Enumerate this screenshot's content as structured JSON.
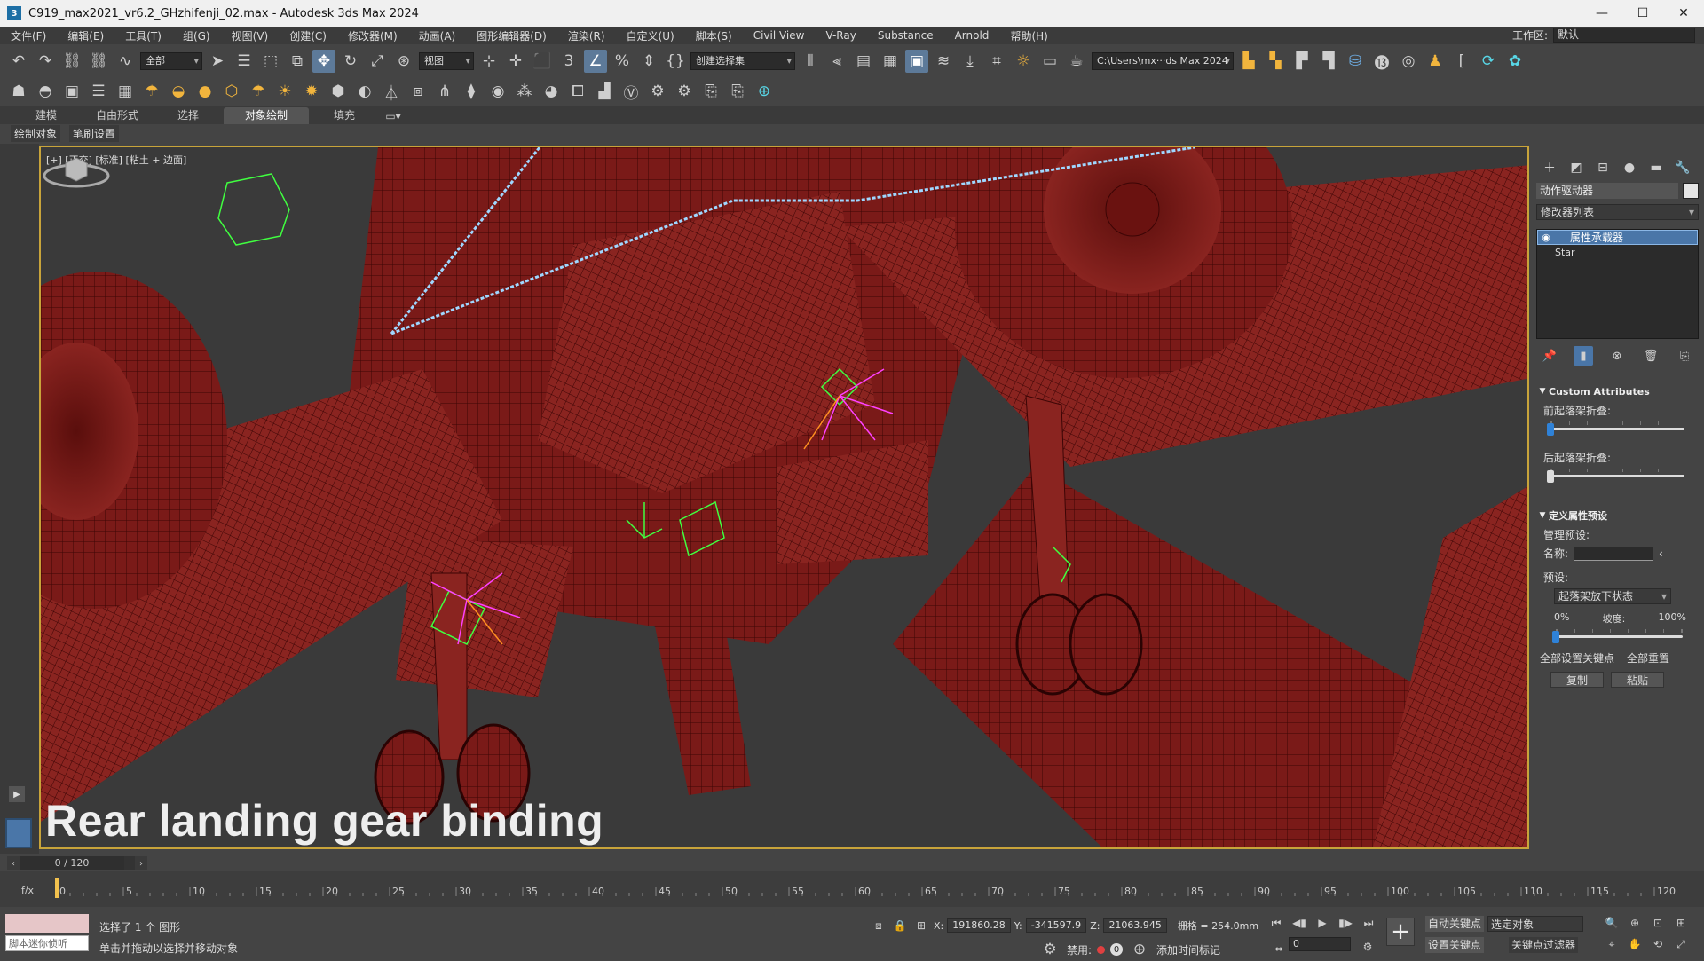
{
  "window": {
    "title": "C919_max2021_vr6.2_GHzhifenji_02.max - Autodesk 3ds Max 2024",
    "logo": "3",
    "controls": [
      "—",
      "☐",
      "✕"
    ]
  },
  "menu": [
    "文件(F)",
    "编辑(E)",
    "工具(T)",
    "组(G)",
    "视图(V)",
    "创建(C)",
    "修改器(M)",
    "动画(A)",
    "图形编辑器(D)",
    "渲染(R)",
    "自定义(U)",
    "脚本(S)",
    "Civil View",
    "V-Ray",
    "Substance",
    "Arnold",
    "帮助(H)"
  ],
  "workspace": {
    "label": "工作区:",
    "value": "默认"
  },
  "toolbar": {
    "filter_select": "全部",
    "ref_coord_select": "视图",
    "named_selection": "创建选择集",
    "project_path": "C:\\Users\\mx···ds Max 2024"
  },
  "ribbon": {
    "tabs": [
      "建模",
      "自由形式",
      "选择",
      "对象绘制",
      "填充"
    ],
    "active_tab": "对象绘制",
    "subtabs": [
      "绘制对象",
      "笔刷设置"
    ]
  },
  "viewport": {
    "label": "[+] [正交] [标准] [粘土 + 边面]",
    "caption": "Rear landing gear binding",
    "colors": {
      "mesh": "#7a1a18",
      "wire": "#3c0505",
      "background": "#3a3a3a",
      "border": "#c8a43a",
      "spline": "#9fd7ff"
    }
  },
  "command_panel": {
    "object_name": "动作驱动器",
    "modifier_list": "修改器列表",
    "stack": [
      "属性承载器",
      "Star"
    ],
    "rollout1": {
      "title": "Custom Attributes",
      "slider1_label": "前起落架折叠:",
      "slider2_label": "后起落架折叠:",
      "slider1_value": 0,
      "slider2_value": 0
    },
    "rollout2": {
      "title": "定义属性预设",
      "manage_label": "管理预设:",
      "name_label": "名称:",
      "preset_label": "预设:",
      "preset_value": "起落架放下状态",
      "pct_min": "0%",
      "slope_label": "坡度:",
      "pct_max": "100%",
      "slope_value": 0,
      "btn_set_all": "全部设置关键点",
      "btn_reset_all": "全部重置",
      "btn_copy": "复制",
      "btn_paste": "粘贴"
    }
  },
  "timeline": {
    "frame_display": "0 / 120",
    "current_frame": 0,
    "max_frame": 120,
    "tick_labels": [
      "0",
      "5",
      "10",
      "15",
      "20",
      "25",
      "30",
      "35",
      "40",
      "45",
      "50",
      "55",
      "60",
      "65",
      "70",
      "75",
      "80",
      "85",
      "90",
      "95",
      "100",
      "105",
      "110",
      "115",
      "120"
    ]
  },
  "status": {
    "mini_listener": "脚本迷你侦听",
    "selection": "选择了 1 个 图形",
    "hint": "单击并拖动以选择并移动对象",
    "x_label": "X:",
    "x": "191860.28",
    "y_label": "Y:",
    "y": "-341597.9",
    "z_label": "Z:",
    "z": "21063.945",
    "grid": "栅格 = 254.0mm",
    "disabled": "禁用:",
    "zero": "0",
    "add_time_tag": "添加时间标记",
    "auto_key": "自动关键点",
    "key_select": "选定对象",
    "set_key": "设置关键点",
    "key_filter": "关键点过滤器",
    "frame_value": "0"
  }
}
